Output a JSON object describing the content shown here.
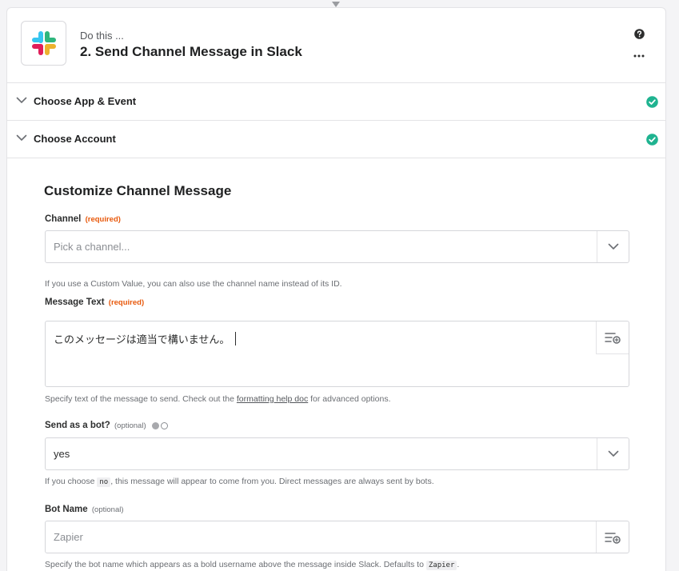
{
  "step": {
    "kicker": "Do this ...",
    "title": "2. Send Channel Message in Slack",
    "app_icon": "slack-logo-icon"
  },
  "sections": [
    {
      "label": "Choose App & Event",
      "status": "complete"
    },
    {
      "label": "Choose Account",
      "status": "complete"
    }
  ],
  "form": {
    "title": "Customize Channel Message",
    "channel": {
      "label": "Channel",
      "tag": "(required)",
      "placeholder": "Pick a channel...",
      "help": "If you use a Custom Value, you can also use the channel name instead of its ID."
    },
    "message_text": {
      "label": "Message Text",
      "tag": "(required)",
      "value": "このメッセージは適当で構いません。",
      "help_before": "Specify text of the message to send. Check out the ",
      "help_link": "formatting help doc",
      "help_after": " for advanced options."
    },
    "send_as_bot": {
      "label": "Send as a bot?",
      "tag": "(optional)",
      "value": "yes",
      "help_before": "If you choose ",
      "help_code": "no",
      "help_after": ", this message will appear to come from you. Direct messages are always sent by bots."
    },
    "bot_name": {
      "label": "Bot Name",
      "tag": "(optional)",
      "placeholder": "Zapier",
      "help_before": "Specify the bot name which appears as a bold username above the message inside Slack. Defaults to ",
      "help_code": "Zapier",
      "help_after": "."
    }
  },
  "colors": {
    "success": "#1fb390",
    "required": "#e8590c",
    "slack_blue": "#36c5f0",
    "slack_green": "#2eb67d",
    "slack_red": "#e01e5a",
    "slack_yellow": "#ecb22e"
  }
}
